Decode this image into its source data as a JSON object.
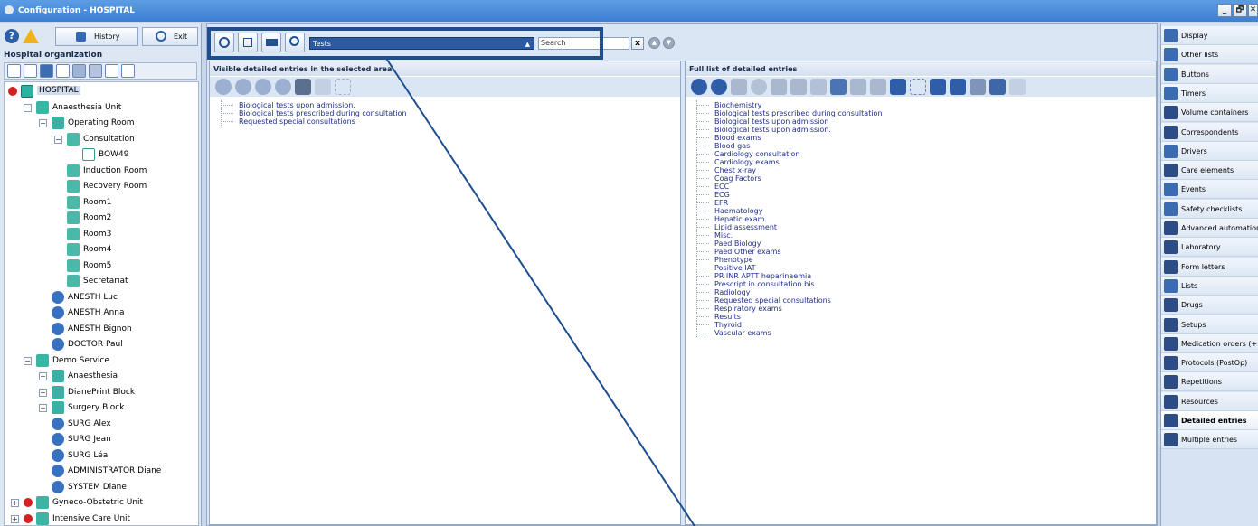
{
  "window": {
    "title": "Configuration - HOSPITAL",
    "min_label": "_",
    "max_label": "🗗",
    "close_label": "✕"
  },
  "left": {
    "history_label": "History",
    "exit_label": "Exit",
    "org_label": "Hospital organization",
    "tree": [
      {
        "label": "HOSPITAL",
        "level": 0,
        "kind": "hospital"
      },
      {
        "label": "Anaesthesia Unit",
        "level": 1,
        "kind": "unit"
      },
      {
        "label": "Operating Room",
        "level": 2,
        "kind": "block"
      },
      {
        "label": "Consultation",
        "level": 3,
        "kind": "room"
      },
      {
        "label": "BOW49",
        "level": 4,
        "kind": "bed"
      },
      {
        "label": "Induction Room",
        "level": 3,
        "kind": "room"
      },
      {
        "label": "Recovery Room",
        "level": 3,
        "kind": "room"
      },
      {
        "label": "Room1",
        "level": 3,
        "kind": "room"
      },
      {
        "label": "Room2",
        "level": 3,
        "kind": "room"
      },
      {
        "label": "Room3",
        "level": 3,
        "kind": "room"
      },
      {
        "label": "Room4",
        "level": 3,
        "kind": "room"
      },
      {
        "label": "Room5",
        "level": 3,
        "kind": "room"
      },
      {
        "label": "Secretariat",
        "level": 3,
        "kind": "room"
      },
      {
        "label": "ANESTH Luc",
        "level": 2,
        "kind": "user"
      },
      {
        "label": "ANESTH Anna",
        "level": 2,
        "kind": "user"
      },
      {
        "label": "ANESTH Bignon",
        "level": 2,
        "kind": "user"
      },
      {
        "label": "DOCTOR Paul",
        "level": 2,
        "kind": "user"
      },
      {
        "label": "Demo Service",
        "level": 1,
        "kind": "unit"
      },
      {
        "label": "Anaesthesia",
        "level": 2,
        "kind": "block"
      },
      {
        "label": "DianePrint Block",
        "level": 2,
        "kind": "block"
      },
      {
        "label": "Surgery Block",
        "level": 2,
        "kind": "block"
      },
      {
        "label": "SURG Alex",
        "level": 2,
        "kind": "user2"
      },
      {
        "label": "SURG Jean",
        "level": 2,
        "kind": "user2"
      },
      {
        "label": "SURG Léa",
        "level": 2,
        "kind": "user2"
      },
      {
        "label": "ADMINISTRATOR Diane",
        "level": 2,
        "kind": "admin"
      },
      {
        "label": "SYSTEM Diane",
        "level": 2,
        "kind": "admin"
      },
      {
        "label": "Gyneco-Obstetric Unit",
        "level": 1,
        "kind": "unit-red"
      },
      {
        "label": "Intensive Care Unit",
        "level": 1,
        "kind": "unit-red"
      }
    ]
  },
  "toolbar": {
    "combo_value": "Tests",
    "search_placeholder": "Search",
    "clear_label": "x"
  },
  "visible_panel": {
    "title": "Visible detailed entries in the selected area",
    "entries": [
      "Biological tests upon admission.",
      "Biological tests prescribed during consultation",
      "Requested special consultations"
    ]
  },
  "full_panel": {
    "title": "Full list of detailed entries",
    "entries": [
      "Biochemistry",
      "Biological tests prescribed during consultation",
      "Biological tests upon admission",
      "Biological tests upon admission.",
      "Blood exams",
      "Blood gas",
      "Cardiology consultation",
      "Cardiology exams",
      "Chest x-ray",
      "Coag Factors",
      "ECC",
      "ECG",
      "EFR",
      "Haematology",
      "Hepatic exam",
      "Lipid assessment",
      "Misc.",
      "Paed Biology",
      "Paed Other exams",
      "Phenotype",
      "Positive IAT",
      "PR INR APTT heparinaemia",
      "Prescript in consultation bis",
      "Radiology",
      "Requested special consultations",
      "Respiratory exams",
      "Results",
      "Thyroid",
      "Vascular exams"
    ]
  },
  "sidebar": {
    "items": [
      {
        "label": "Display",
        "icon": "display-icon",
        "color": "#3b6bb0"
      },
      {
        "label": "Other lists",
        "icon": "list-icon",
        "color": "#3b6bb0"
      },
      {
        "label": "Buttons",
        "icon": "buttons-icon",
        "color": "#3b6bb0"
      },
      {
        "label": "Timers",
        "icon": "timer-icon",
        "color": "#3b6bb0"
      },
      {
        "label": "Volume containers",
        "icon": "syringe-icon",
        "color": "#2d4c86"
      },
      {
        "label": "Correspondents",
        "icon": "contact-icon",
        "color": "#2d4c86"
      },
      {
        "label": "Drivers",
        "icon": "driver-icon",
        "color": "#3b6bb0"
      },
      {
        "label": "Care elements",
        "icon": "care-icon",
        "color": "#2d4c86"
      },
      {
        "label": "Events",
        "icon": "events-icon",
        "color": "#3b6bb0"
      },
      {
        "label": "Safety checklists",
        "icon": "checklist-icon",
        "color": "#3b6bb0"
      },
      {
        "label": "Advanced automations",
        "icon": "automation-icon",
        "color": "#2d4c86"
      },
      {
        "label": "Laboratory",
        "icon": "microscope-icon",
        "color": "#2d4c86"
      },
      {
        "label": "Form letters",
        "icon": "letter-icon",
        "color": "#2d4c86"
      },
      {
        "label": "Lists",
        "icon": "lists-icon",
        "color": "#3b6bb0"
      },
      {
        "label": "Drugs",
        "icon": "drugs-icon",
        "color": "#2d4c86"
      },
      {
        "label": "Setups",
        "icon": "gears-icon",
        "color": "#2d4c86"
      },
      {
        "label": "Medication orders (+ Fav",
        "icon": "medication-icon",
        "color": "#2d4c86"
      },
      {
        "label": "Protocols (PostOp)",
        "icon": "protocol-icon",
        "color": "#2d4c86"
      },
      {
        "label": "Repetitions",
        "icon": "repeat-icon",
        "color": "#2d4c86"
      },
      {
        "label": "Resources",
        "icon": "resources-icon",
        "color": "#2d4c86"
      },
      {
        "label": "Detailed entries",
        "icon": "detailed-entries-icon",
        "color": "#2d4c86",
        "selected": true
      },
      {
        "label": "Multiple entries",
        "icon": "multiple-entries-icon",
        "color": "#2d4c86"
      }
    ]
  }
}
